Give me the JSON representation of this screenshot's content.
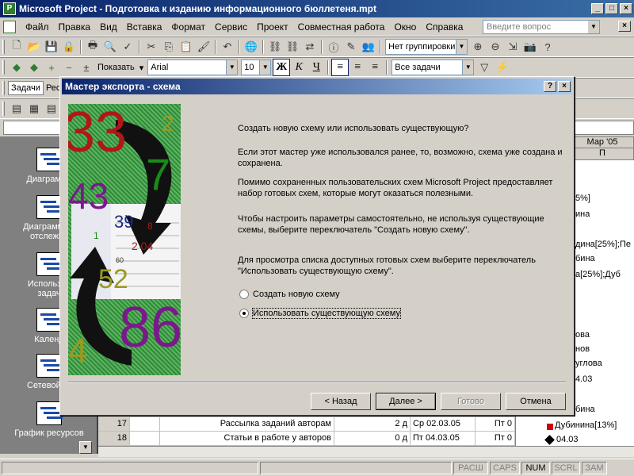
{
  "window": {
    "title": "Microsoft Project - Подготовка к изданию информационного бюллетеня.mpt",
    "app_icon_letter": "P"
  },
  "menu": {
    "items": [
      "Файл",
      "Правка",
      "Вид",
      "Вставка",
      "Формат",
      "Сервис",
      "Проект",
      "Совместная работа",
      "Окно",
      "Справка"
    ],
    "help_placeholder": "Введите вопрос"
  },
  "toolbar1": {
    "grouping": "Нет группировки"
  },
  "toolbar2": {
    "show_label": "Показать",
    "font": "Arial",
    "size": "10",
    "bold": "Ж",
    "italic": "К",
    "underline": "Ч",
    "filter": "Все задачи"
  },
  "toolbar3": {
    "tasks_tab": "Задачи",
    "resources_tab": "Рес"
  },
  "viewbar": {
    "items": [
      {
        "label": "Диаграмма"
      },
      {
        "label": "Диаграмма с отслежив"
      },
      {
        "label": "Использов задач"
      },
      {
        "label": "Календ"
      },
      {
        "label": "Сетевой гр"
      },
      {
        "label": "График ресурсов"
      }
    ]
  },
  "gantt": {
    "month": "Мар '05",
    "day": "П",
    "labels": [
      "5%]",
      "ина",
      "дина[25%];Пе",
      "бина",
      "а[25%];Дуб",
      "ова",
      "нов",
      "углова",
      "4.03",
      "бина",
      "Дубинина[13%]",
      "04.03"
    ]
  },
  "table": {
    "rows": [
      {
        "id": "17",
        "name": "Рассылка заданий авторам",
        "duration": "2 д",
        "start": "Ср 02.03.05",
        "finish": "Пт 0"
      },
      {
        "id": "18",
        "name": "Статьи в работе у авторов",
        "duration": "0 д",
        "start": "Пт 04.03.05",
        "finish": "Пт 0"
      }
    ]
  },
  "status": {
    "fields": [
      "РАСШ",
      "CAPS",
      "NUM",
      "SCRL",
      "ЗАМ"
    ]
  },
  "dialog": {
    "title": "Мастер экспорта - схема",
    "art_numbers": [
      "33",
      "2",
      "7",
      "43",
      "39",
      "8",
      "1",
      "2 04",
      "60",
      "52",
      "86",
      "4"
    ],
    "question": "Создать новую схему или использовать существующую?",
    "para1": "Если этот мастер уже использовался ранее, то, возможно, схема уже создана и сохранена.",
    "para2": "Помимо сохраненных пользовательских схем Microsoft Project предоставляет набор готовых схем, которые могут оказаться полезными.",
    "para3": "Чтобы настроить параметры самостоятельно, не используя существующие схемы, выберите переключатель \"Создать новую схему\".",
    "para4": "Для просмотра списка доступных готовых схем выберите переключатель \"Использовать существующую схему\".",
    "option_new": "Создать новую схему",
    "option_existing": "Использовать существующую схему",
    "back": "< Назад",
    "next": "Далее >",
    "finish": "Готово",
    "cancel": "Отмена"
  }
}
